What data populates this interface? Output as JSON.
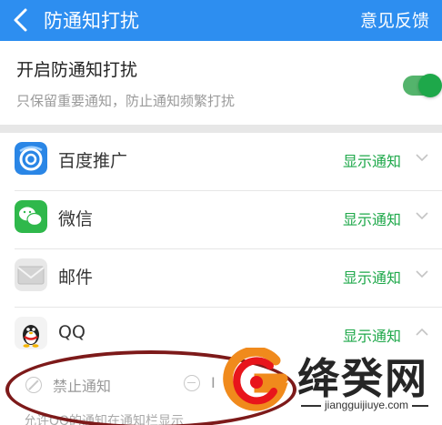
{
  "header": {
    "title": "防通知打扰",
    "feedback_label": "意见反馈"
  },
  "toggle_section": {
    "title": "开启防通知打扰",
    "subtitle": "只保留重要通知，防止通知频繁打扰",
    "enabled": true
  },
  "apps": [
    {
      "name": "百度推广",
      "status": "显示通知",
      "expanded": false,
      "icon": "baidu-tuiguang-icon"
    },
    {
      "name": "微信",
      "status": "显示通知",
      "expanded": false,
      "icon": "wechat-icon"
    },
    {
      "name": "邮件",
      "status": "显示通知",
      "expanded": false,
      "icon": "mail-icon"
    },
    {
      "name": "QQ",
      "status": "显示通知",
      "expanded": true,
      "icon": "qq-icon"
    }
  ],
  "options": {
    "block_label": "禁止通知",
    "second_label": "I"
  },
  "hint": "允许QQ的通知在通知栏显示",
  "watermark": {
    "name": "绛癸网",
    "url": "jiangguijiuye.com"
  },
  "colors": {
    "header_bg": "#2d8ef0",
    "accent_green": "#1ea84a",
    "annotation_red": "#7d1a1a"
  }
}
